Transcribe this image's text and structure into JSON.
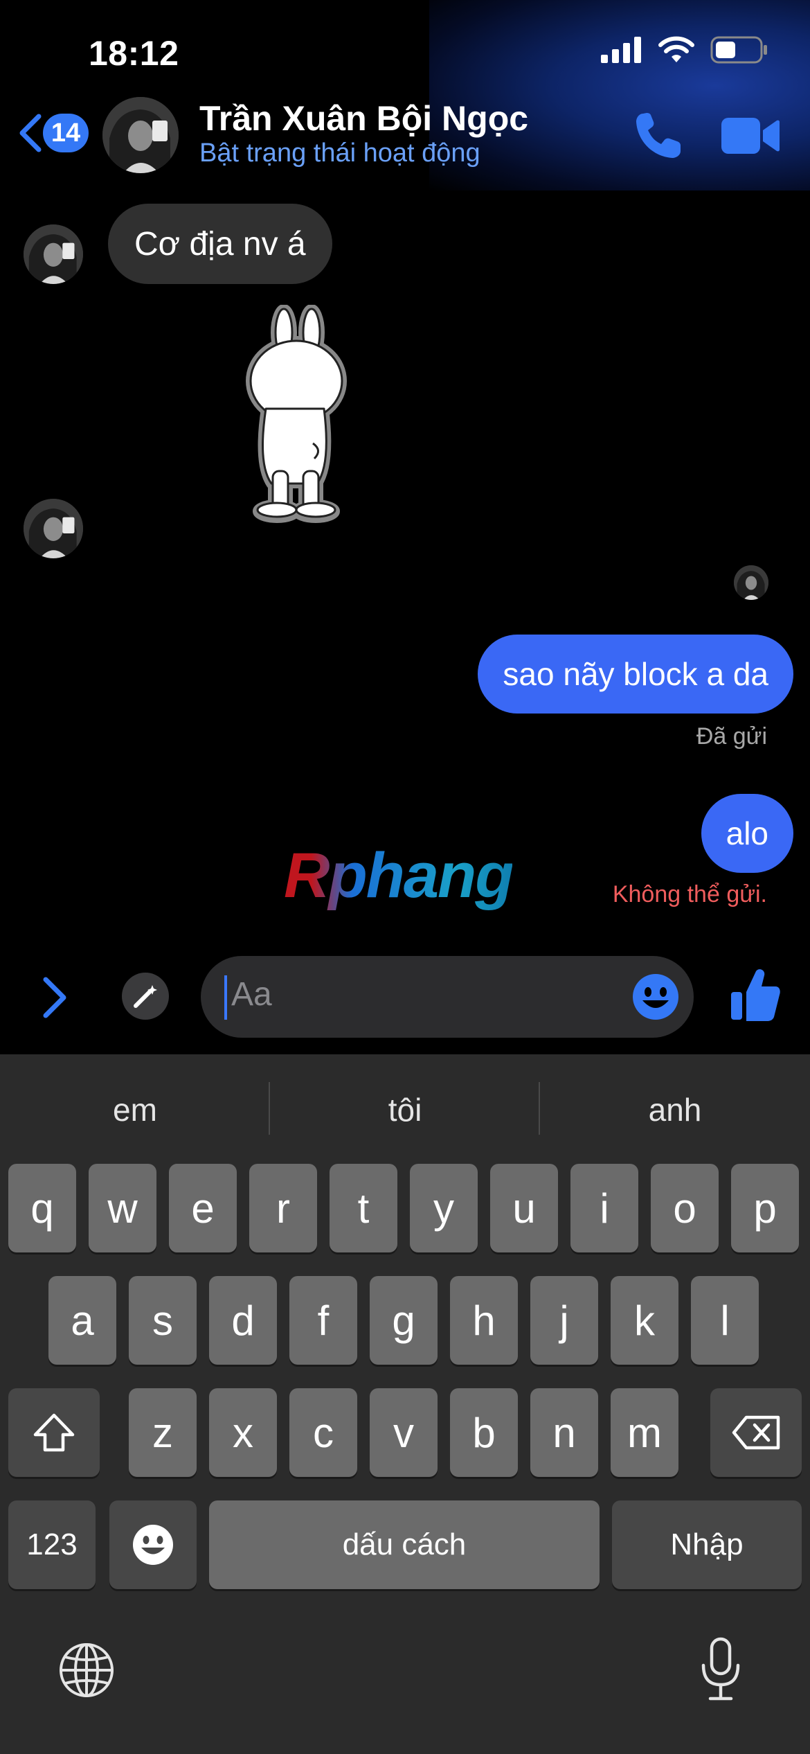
{
  "status": {
    "time": "18:12"
  },
  "header": {
    "back_count": "14",
    "contact_name": "Trần Xuân Bội Ngọc",
    "contact_status": "Bật trạng thái hoạt động"
  },
  "messages": {
    "incoming_text": "Cơ địa nv á",
    "outgoing_1": "sao nãy block a da",
    "outgoing_1_status": "Đã gửi",
    "outgoing_2": "alo",
    "outgoing_2_status": "Không thể gửi."
  },
  "watermark": "Rphang",
  "composer": {
    "placeholder": "Aa"
  },
  "keyboard": {
    "suggestions": [
      "em",
      "tôi",
      "anh"
    ],
    "row1": [
      "q",
      "w",
      "e",
      "r",
      "t",
      "y",
      "u",
      "i",
      "o",
      "p"
    ],
    "row2": [
      "a",
      "s",
      "d",
      "f",
      "g",
      "h",
      "j",
      "k",
      "l"
    ],
    "row3": [
      "z",
      "x",
      "c",
      "v",
      "b",
      "n",
      "m"
    ],
    "numbers_label": "123",
    "space_label": "dấu cách",
    "return_label": "Nhập"
  },
  "colors": {
    "accent": "#3478f6",
    "outgoing_bubble": "#3a68f5",
    "incoming_bubble": "#303030",
    "error": "#f05d5d"
  }
}
